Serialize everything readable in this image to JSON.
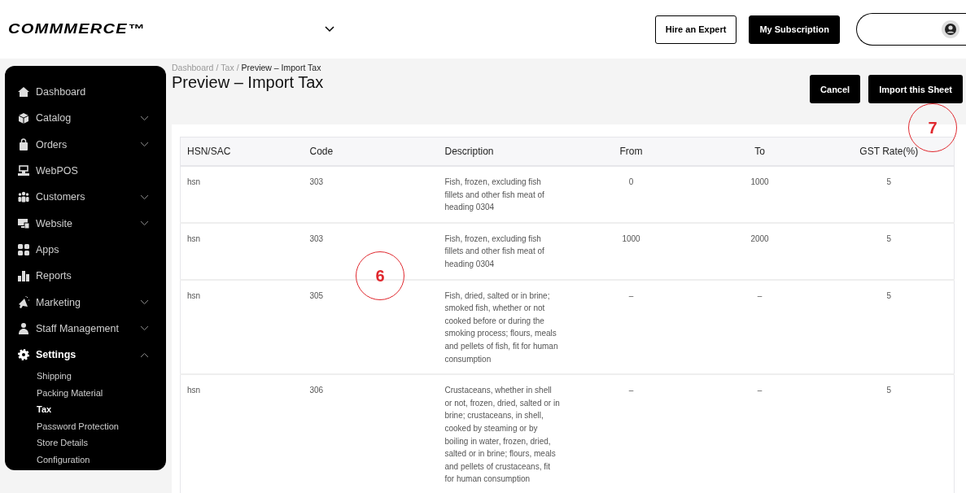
{
  "header": {
    "logo": "COMMMERCE™",
    "buttons": [
      {
        "label": "Hire an Expert",
        "kind": "outline"
      },
      {
        "label": "My Subscription",
        "kind": "filled"
      }
    ]
  },
  "sidebar": {
    "items": [
      {
        "label": "Dashboard",
        "kind": "link",
        "selected": false
      },
      {
        "label": "Catalog",
        "kind": "group",
        "expanded": false,
        "selected": false
      },
      {
        "label": "Orders",
        "kind": "group",
        "expanded": false,
        "selected": false
      },
      {
        "label": "WebPOS",
        "kind": "link",
        "selected": false
      },
      {
        "label": "Customers",
        "kind": "group",
        "expanded": false,
        "selected": false
      },
      {
        "label": "Website",
        "kind": "group",
        "expanded": false,
        "selected": false
      },
      {
        "label": "Apps",
        "kind": "link",
        "selected": false
      },
      {
        "label": "Reports",
        "kind": "link",
        "selected": false
      },
      {
        "label": "Marketing",
        "kind": "group",
        "expanded": false,
        "selected": false
      },
      {
        "label": "Staff Management",
        "kind": "group",
        "expanded": false,
        "selected": false
      },
      {
        "label": "Settings",
        "kind": "group",
        "expanded": true,
        "selected": true,
        "children": [
          {
            "label": "Shipping",
            "selected": false
          },
          {
            "label": "Packing Material",
            "selected": false
          },
          {
            "label": "Tax",
            "selected": true
          },
          {
            "label": "Password Protection",
            "selected": false
          },
          {
            "label": "Store Details",
            "selected": false
          },
          {
            "label": "Configuration",
            "selected": false
          }
        ]
      }
    ]
  },
  "breadcrumb": [
    {
      "label": "Dashboard",
      "current": false
    },
    {
      "label": "Tax",
      "current": false
    },
    {
      "label": "Preview – Import Tax",
      "current": true
    }
  ],
  "breadcrumb_separator": "/",
  "page_title": "Preview – Import Tax",
  "actions": [
    "Cancel",
    "Import this Sheet"
  ],
  "table": {
    "columns": [
      "HSN/SAC",
      "Code",
      "Description",
      "From",
      "To",
      "GST Rate(%)"
    ],
    "rows": [
      [
        "hsn",
        "303",
        "Fish, frozen, excluding fish fillets and other fish meat of heading 0304",
        "0",
        "1000",
        "5"
      ],
      [
        "hsn",
        "303",
        "Fish, frozen, excluding fish fillets and other fish meat of heading 0304",
        "1000",
        "2000",
        "5"
      ],
      [
        "hsn",
        "305",
        "Fish, dried, salted or in brine; smoked fish, whether or not cooked before or during the smoking process; flours, meals and pellets of fish, fit for human consumption",
        "–",
        "–",
        "5"
      ],
      [
        "hsn",
        "306",
        "Crustaceans, whether in shell or not, frozen, dried, salted or in brine; crustaceans, in shell, cooked by steaming or by boiling in water, frozen, dried, salted or in brine; flours, meals and pellets of crustaceans, fit for human consumption",
        "–",
        "–",
        "5"
      ]
    ]
  },
  "annotations": [
    {
      "label": "6"
    },
    {
      "label": "7"
    }
  ]
}
